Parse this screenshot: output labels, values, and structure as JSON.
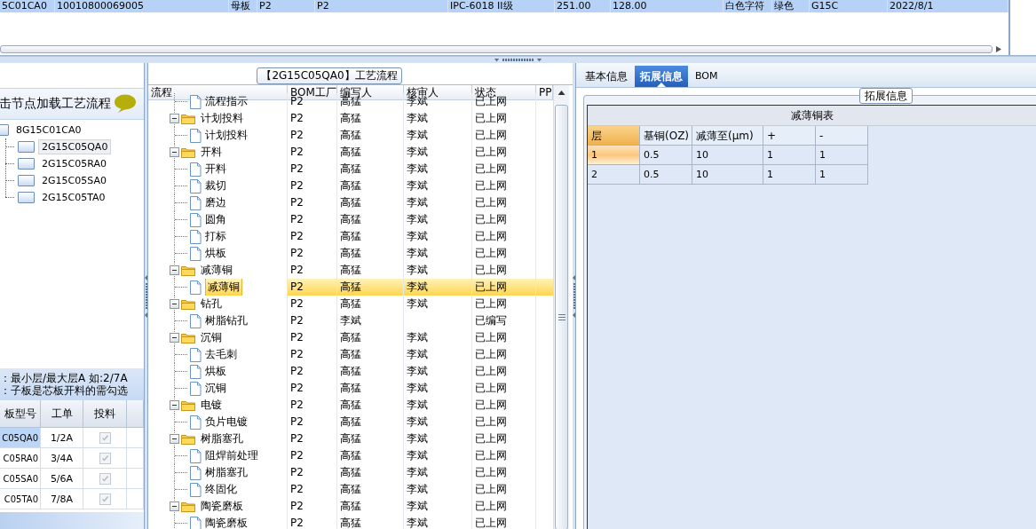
{
  "top_grid": {
    "rows": [
      {
        "selected": true,
        "cells": [
          "5C01CA0",
          "10010800069005",
          "母板",
          "P2",
          "P2",
          "IPC-6018 II级",
          "251.00",
          "128.00",
          "白色字符",
          "绿色",
          "G15C",
          "2022/8/1"
        ]
      }
    ]
  },
  "board_panel": {
    "hint": "击节点加载工艺流程",
    "tree": {
      "label": "8G15C01CA0",
      "children": [
        {
          "label": "2G15C05QA0",
          "selected": true
        },
        {
          "label": "2G15C05RA0",
          "selected": false
        },
        {
          "label": "2G15C05SA0",
          "selected": false
        },
        {
          "label": "2G15C05TA0",
          "selected": false
        }
      ]
    },
    "notes": [
      "：最小层/最大层A 如:2/7A",
      "：子板是芯板开料的需勾选"
    ],
    "grid": {
      "columns": [
        "板型号",
        "工单",
        "投料"
      ],
      "rows": [
        {
          "board": "C05QA0",
          "order": "1/2A",
          "checked": true,
          "disabled": true,
          "selected": true
        },
        {
          "board": "C05RA0",
          "order": "3/4A",
          "checked": true,
          "disabled": true,
          "selected": false
        },
        {
          "board": "C05SA0",
          "order": "5/6A",
          "checked": true,
          "disabled": true,
          "selected": false
        },
        {
          "board": "C05TA0",
          "order": "7/8A",
          "checked": true,
          "disabled": true,
          "selected": false
        }
      ]
    }
  },
  "process_panel": {
    "title": "【2G15C05QA0】工艺流程",
    "columns": [
      "流程",
      "BOM工厂",
      "编写人",
      "核审人",
      "状态",
      "PP"
    ],
    "groups": [
      {
        "children": [
          {
            "name": "流程指示",
            "factory": "P2",
            "author": "高猛",
            "reviewer": "李斌",
            "status": "已上网",
            "selected": false
          }
        ]
      },
      {
        "name": "计划投料",
        "factory": "P2",
        "author": "高猛",
        "reviewer": "李斌",
        "status": "已上网",
        "expanded": true,
        "children": [
          {
            "name": "计划投料",
            "factory": "P2",
            "author": "高猛",
            "reviewer": "李斌",
            "status": "已上网",
            "selected": false
          }
        ]
      },
      {
        "name": "开料",
        "factory": "P2",
        "author": "高猛",
        "reviewer": "李斌",
        "status": "已上网",
        "expanded": true,
        "children": [
          {
            "name": "开料",
            "factory": "P2",
            "author": "高猛",
            "reviewer": "李斌",
            "status": "已上网",
            "selected": false
          },
          {
            "name": "裁切",
            "factory": "P2",
            "author": "高猛",
            "reviewer": "李斌",
            "status": "已上网",
            "selected": false
          },
          {
            "name": "磨边",
            "factory": "P2",
            "author": "高猛",
            "reviewer": "李斌",
            "status": "已上网",
            "selected": false
          },
          {
            "name": "圆角",
            "factory": "P2",
            "author": "高猛",
            "reviewer": "李斌",
            "status": "已上网",
            "selected": false
          },
          {
            "name": "打标",
            "factory": "P2",
            "author": "高猛",
            "reviewer": "李斌",
            "status": "已上网",
            "selected": false
          },
          {
            "name": "烘板",
            "factory": "P2",
            "author": "高猛",
            "reviewer": "李斌",
            "status": "已上网",
            "selected": false
          }
        ]
      },
      {
        "name": "减薄铜",
        "factory": "P2",
        "author": "高猛",
        "reviewer": "李斌",
        "status": "已上网",
        "expanded": true,
        "children": [
          {
            "name": "减薄铜",
            "factory": "P2",
            "author": "高猛",
            "reviewer": "李斌",
            "status": "已上网",
            "selected": true
          }
        ]
      },
      {
        "name": "钻孔",
        "factory": "P2",
        "author": "高猛",
        "reviewer": "李斌",
        "status": "已上网",
        "expanded": true,
        "children": [
          {
            "name": "树脂钻孔",
            "factory": "P2",
            "author": "李斌",
            "status": "已编写",
            "selected": false
          }
        ]
      },
      {
        "name": "沉铜",
        "factory": "P2",
        "author": "高猛",
        "reviewer": "李斌",
        "status": "已上网",
        "expanded": true,
        "children": [
          {
            "name": "去毛刺",
            "factory": "P2",
            "author": "高猛",
            "reviewer": "李斌",
            "status": "已上网",
            "selected": false
          },
          {
            "name": "烘板",
            "factory": "P2",
            "author": "高猛",
            "reviewer": "李斌",
            "status": "已上网",
            "selected": false
          },
          {
            "name": "沉铜",
            "factory": "P2",
            "author": "高猛",
            "reviewer": "李斌",
            "status": "已上网",
            "selected": false
          }
        ]
      },
      {
        "name": "电镀",
        "factory": "P2",
        "author": "高猛",
        "reviewer": "李斌",
        "status": "已上网",
        "expanded": true,
        "children": [
          {
            "name": "负片电镀",
            "factory": "P2",
            "author": "高猛",
            "reviewer": "李斌",
            "status": "已上网",
            "selected": false
          }
        ]
      },
      {
        "name": "树脂塞孔",
        "factory": "P2",
        "author": "高猛",
        "reviewer": "李斌",
        "status": "已上网",
        "expanded": true,
        "children": [
          {
            "name": "阻焊前处理",
            "factory": "P2",
            "author": "高猛",
            "reviewer": "李斌",
            "status": "已上网",
            "selected": false
          },
          {
            "name": "树脂塞孔",
            "factory": "P2",
            "author": "高猛",
            "reviewer": "李斌",
            "status": "已上网",
            "selected": false
          },
          {
            "name": "终固化",
            "factory": "P2",
            "author": "高猛",
            "reviewer": "李斌",
            "status": "已上网",
            "selected": false
          }
        ]
      },
      {
        "name": "陶瓷磨板",
        "factory": "P2",
        "author": "高猛",
        "reviewer": "李斌",
        "status": "已上网",
        "expanded": true,
        "children": [
          {
            "name": "陶瓷磨板",
            "factory": "P2",
            "author": "高猛",
            "reviewer": "李斌",
            "status": "已上网",
            "selected": false
          }
        ]
      }
    ]
  },
  "info_panel": {
    "tabs": [
      {
        "label": "基本信息",
        "selected": false
      },
      {
        "label": "拓展信息",
        "selected": true
      },
      {
        "label": "BOM",
        "selected": false
      }
    ],
    "group_title": "拓展信息",
    "table": {
      "title": "减薄铜表",
      "columns": [
        "层",
        "基铜(OZ)",
        "减薄至(μm)",
        "+",
        "-"
      ],
      "rows": [
        {
          "selected": true,
          "cells": [
            "1",
            "0.5",
            "10",
            "1",
            "1"
          ]
        },
        {
          "selected": false,
          "cells": [
            "2",
            "0.5",
            "10",
            "1",
            "1"
          ]
        }
      ]
    }
  }
}
